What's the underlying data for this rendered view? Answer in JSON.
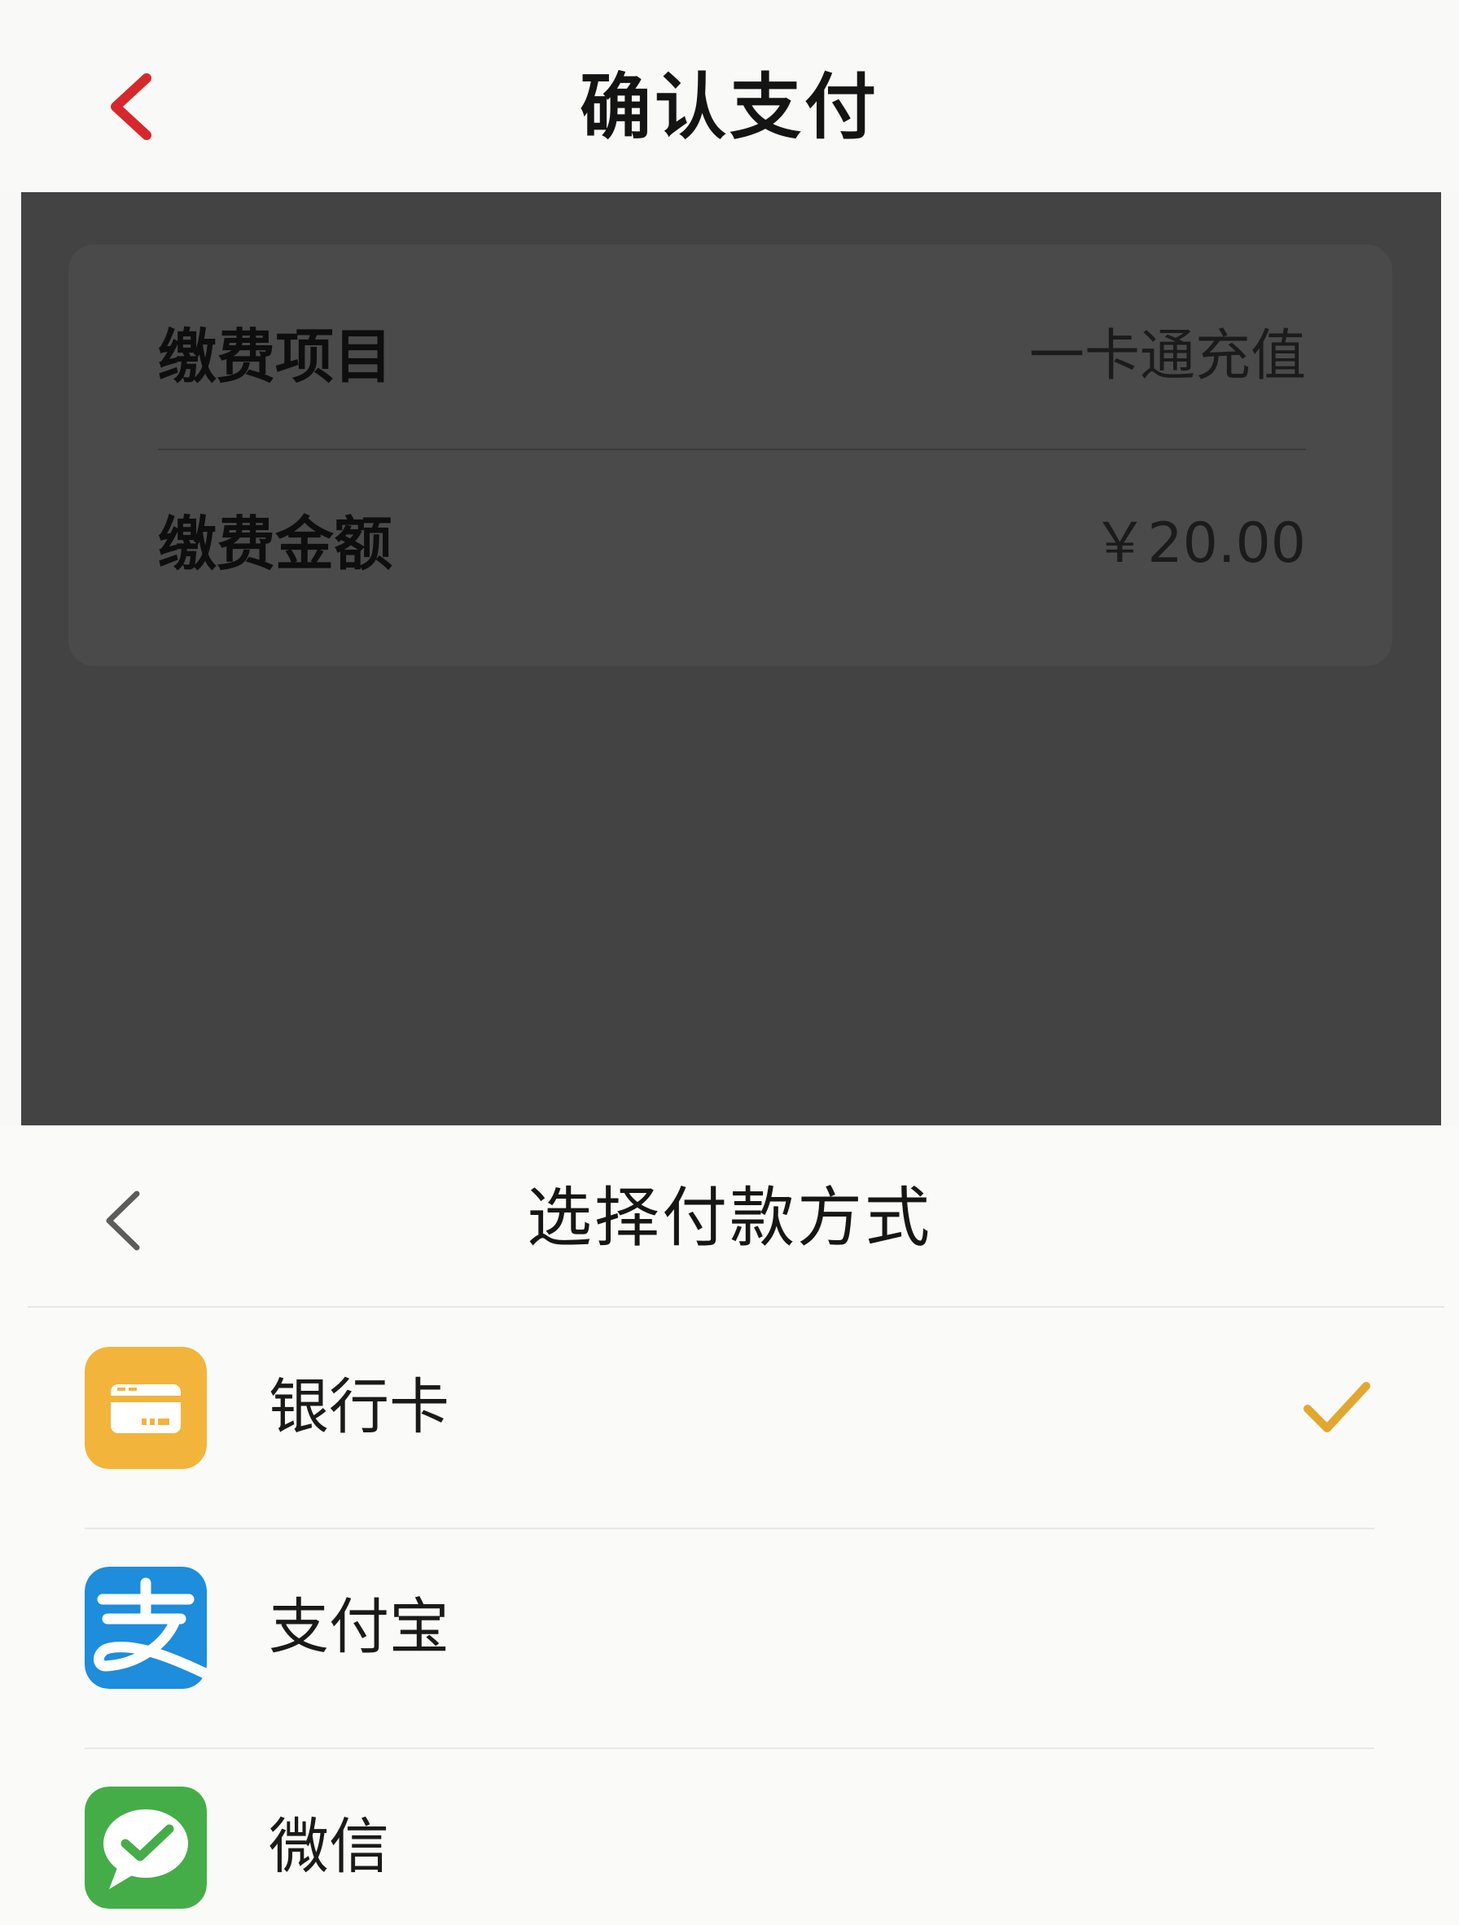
{
  "header": {
    "title": "确认支付"
  },
  "payment_info": {
    "item_label": "缴费项目",
    "item_value": "一卡通充值",
    "amount_label": "缴费金额",
    "amount_value": "￥20.00"
  },
  "payment_sheet": {
    "title": "选择付款方式",
    "methods": [
      {
        "label": "银行卡",
        "icon": "bank-card-icon",
        "selected": true
      },
      {
        "label": "支付宝",
        "icon": "alipay-icon",
        "selected": false
      },
      {
        "label": "微信",
        "icon": "wechat-icon",
        "selected": false
      }
    ]
  },
  "colors": {
    "accent_red": "#d6282c",
    "check_gold": "#e3a72f",
    "bank_yellow": "#f2b43b",
    "alipay_blue": "#1d8ddc",
    "wechat_green": "#45ad47",
    "overlay": "#434343"
  }
}
